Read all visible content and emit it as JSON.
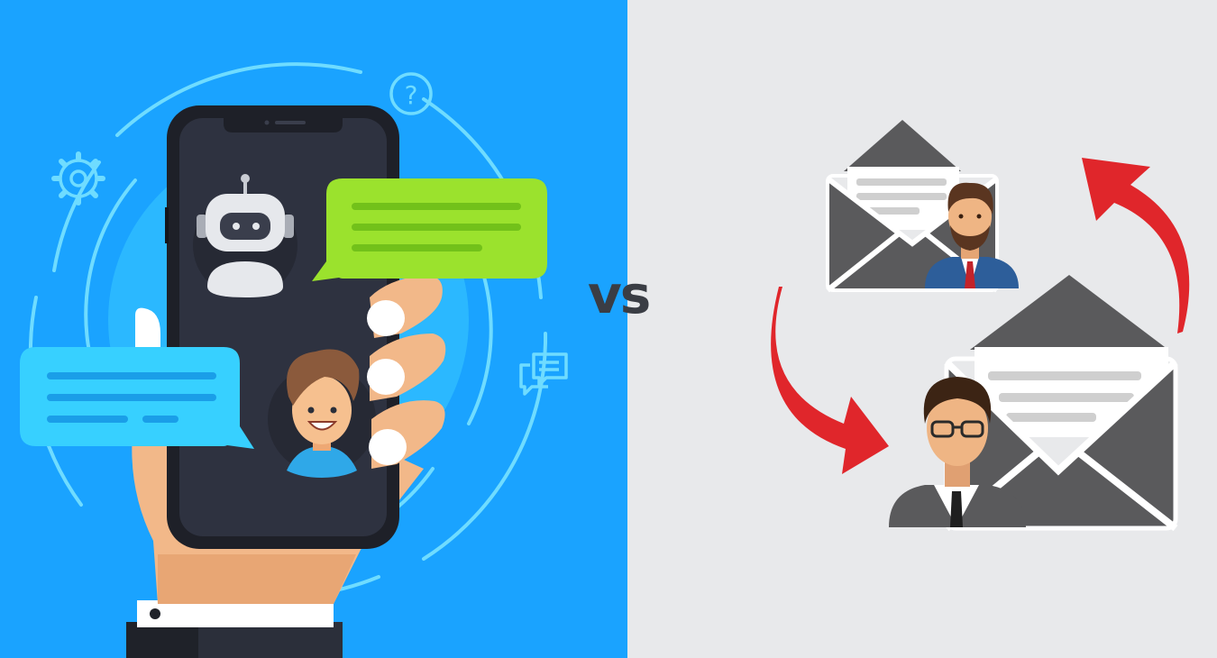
{
  "comparison": {
    "left_concept": "chatbot-messaging",
    "right_concept": "email-exchange",
    "separator_text": "vs"
  },
  "colors": {
    "left_bg": "#1aa3ff",
    "right_bg": "#e8e9eb",
    "phone_body": "#2b2f3a",
    "bot_bubble": "#9be22d",
    "user_bubble": "#37d0ff",
    "envelope": "#5a5a5c",
    "arrow": "#e0262b",
    "vs_text": "#3a3d44"
  },
  "icons": {
    "left": [
      "gear-icon",
      "question-icon",
      "chat-icon",
      "robot-avatar-icon",
      "user-avatar-icon",
      "hand-icon",
      "phone-icon"
    ],
    "right": [
      "envelope-icon",
      "businessman-bearded-icon",
      "businessman-glasses-icon",
      "curved-arrow-icon"
    ]
  }
}
